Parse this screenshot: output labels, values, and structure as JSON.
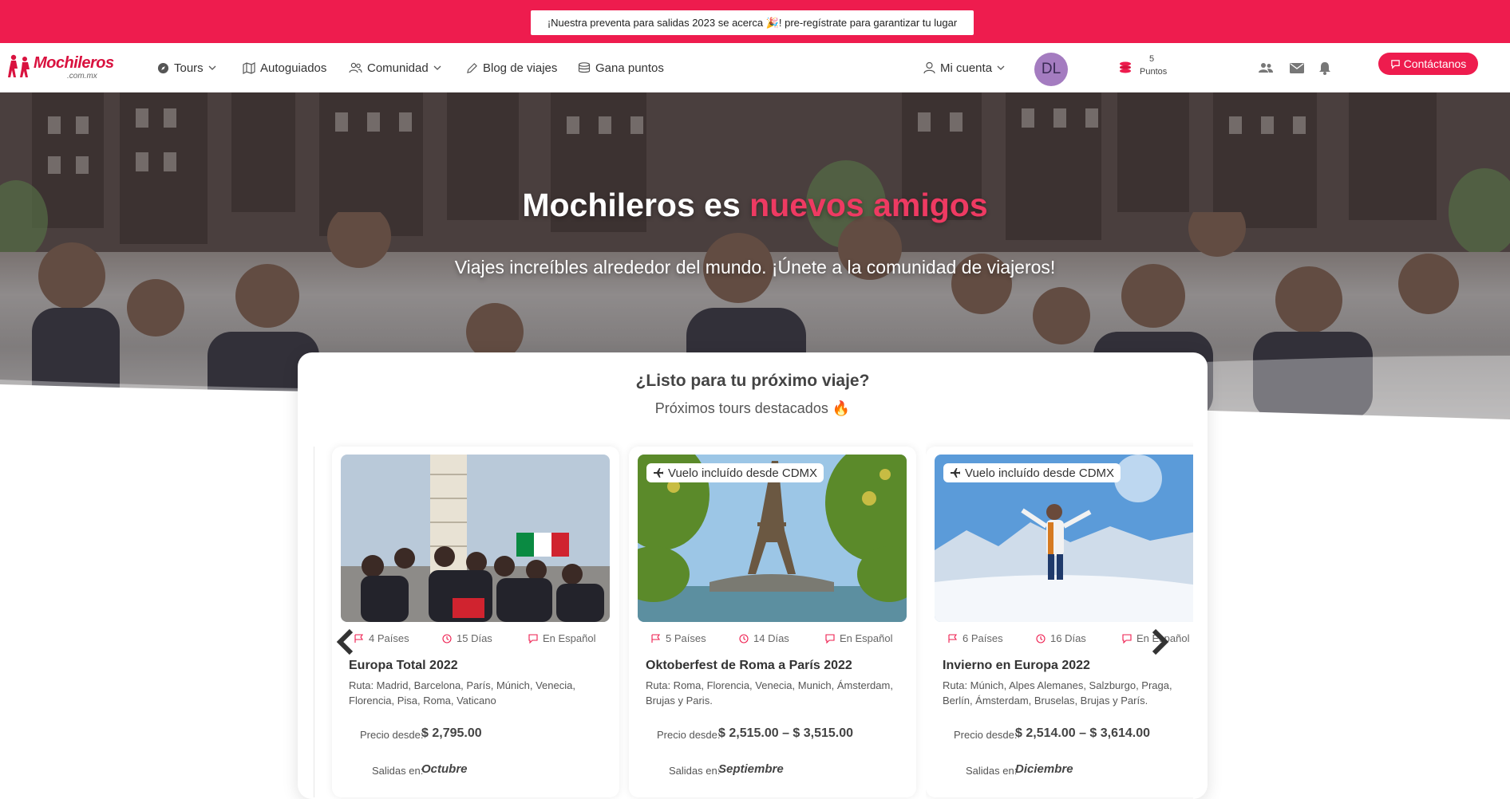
{
  "announcement": "¡Nuestra preventa para salidas 2023 se acerca 🎉! pre-regístrate para garantizar tu lugar",
  "brand": {
    "name": "Mochileros",
    "sub": ".com.mx"
  },
  "nav": {
    "tours": "Tours",
    "autoguiados": "Autoguiados",
    "comunidad": "Comunidad",
    "blog": "Blog de viajes",
    "gana": "Gana puntos",
    "cuenta": "Mi cuenta",
    "avatar": "DL",
    "points_value": "5",
    "points_label": "Puntos",
    "contact": "Contáctanos"
  },
  "hero": {
    "title_main": "Mochileros es ",
    "title_accent": "nuevos amigos",
    "subtitle": "Viajes increíbles alrededor del mundo. ¡Únete a la comunidad de viajeros!"
  },
  "featured": {
    "title": "¿Listo para tu próximo viaje?",
    "subtitle": "Próximos tours destacados 🔥"
  },
  "tours": [
    {
      "badge": "",
      "countries": "4 Países",
      "days": "15 Días",
      "lang": "En Español",
      "name": "Europa Total 2022",
      "route": "Ruta: Madrid, Barcelona, París, Múnich, Venecia, Florencia, Pisa, Roma, Vaticano",
      "price_label": "Precio desde:",
      "price": "$ 2,795.00",
      "dep_label": "Salidas en:",
      "departure": "Octubre"
    },
    {
      "badge": "Vuelo incluído desde CDMX",
      "countries": "5 Países",
      "days": "14 Días",
      "lang": "En Español",
      "name": "Oktoberfest de Roma a París 2022",
      "route": "Ruta: Roma, Florencia, Venecia, Munich, Ámsterdam, Brujas y Paris.",
      "price_label": "Precio desde:",
      "price": "$ 2,515.00 – $ 3,515.00",
      "dep_label": "Salidas en:",
      "departure": "Septiembre"
    },
    {
      "badge": "Vuelo incluído desde CDMX",
      "countries": "6 Países",
      "days": "16 Días",
      "lang": "En Español",
      "name": "Invierno en Europa 2022",
      "route": "Ruta: Múnich, Alpes Alemanes, Salzburgo, Praga, Berlín, Ámsterdam, Bruselas, Brujas y París.",
      "price_label": "Precio desde:",
      "price": "$ 2,514.00 – $ 3,614.00",
      "dep_label": "Salidas en:",
      "departure": "Diciembre"
    }
  ],
  "colors": {
    "brand": "#ee1c4e",
    "accent_text": "#ee3a62"
  },
  "icons": [
    "compass-icon",
    "map-icon",
    "people-icon",
    "pencil-icon",
    "coins-icon",
    "user-icon",
    "friends-icon",
    "mail-icon",
    "bell-icon",
    "chat-icon",
    "flag-icon",
    "clock-icon",
    "plane-icon",
    "chevron-left-icon",
    "chevron-right-icon"
  ]
}
